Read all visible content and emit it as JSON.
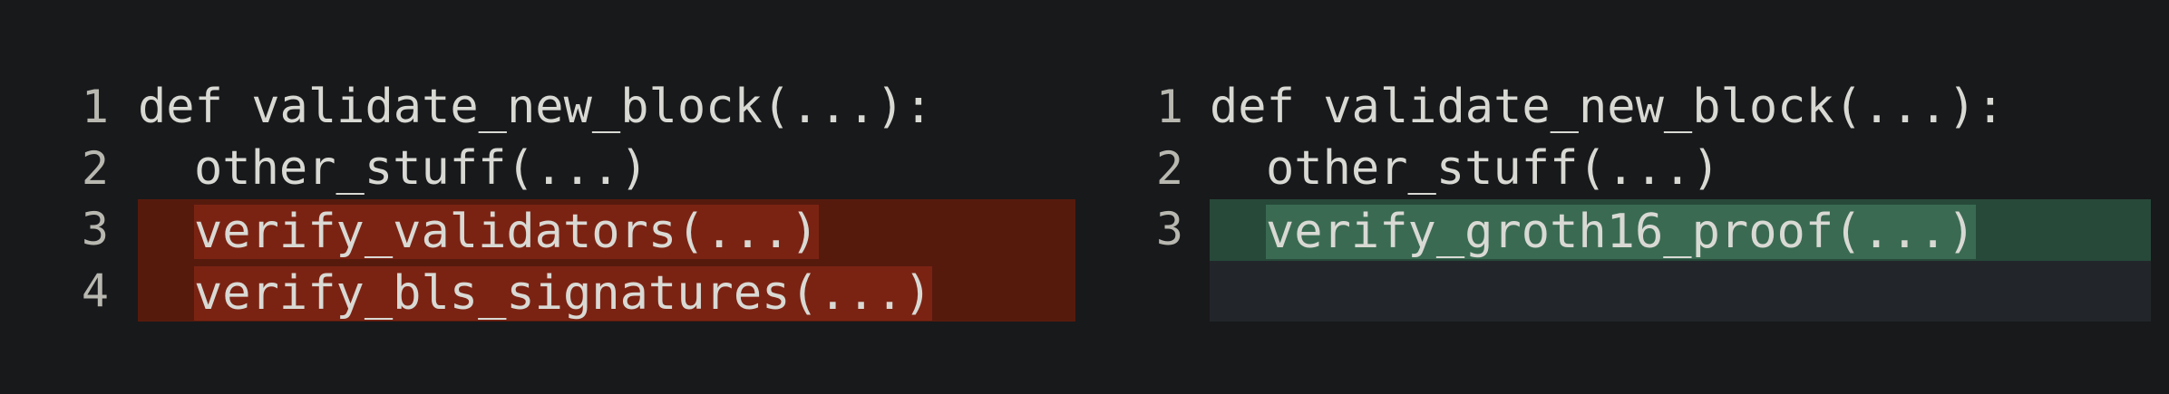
{
  "colors": {
    "background": "#18191b",
    "deleted_line": "#561a0d",
    "deleted_text_highlight": "#7b2313",
    "added_line": "#27493a",
    "added_text_highlight": "#3a6b52",
    "empty_placeholder": "#22262a",
    "text": "#d9d9d4",
    "line_number": "#b8b8b0"
  },
  "left": {
    "lines": [
      {
        "num": "1",
        "code": "def validate_new_block(...):",
        "status": "unchanged"
      },
      {
        "num": "2",
        "code": "other_stuff(...)",
        "status": "unchanged"
      },
      {
        "num": "3",
        "code": "verify_validators(...)",
        "status": "deleted"
      },
      {
        "num": "4",
        "code": "verify_bls_signatures(...)",
        "status": "deleted"
      }
    ]
  },
  "right": {
    "lines": [
      {
        "num": "1",
        "code": "def validate_new_block(...):",
        "status": "unchanged"
      },
      {
        "num": "2",
        "code": "other_stuff(...)",
        "status": "unchanged"
      },
      {
        "num": "3",
        "code": "verify_groth16_proof(...)",
        "status": "added"
      },
      {
        "num": "",
        "code": "",
        "status": "empty"
      }
    ]
  }
}
